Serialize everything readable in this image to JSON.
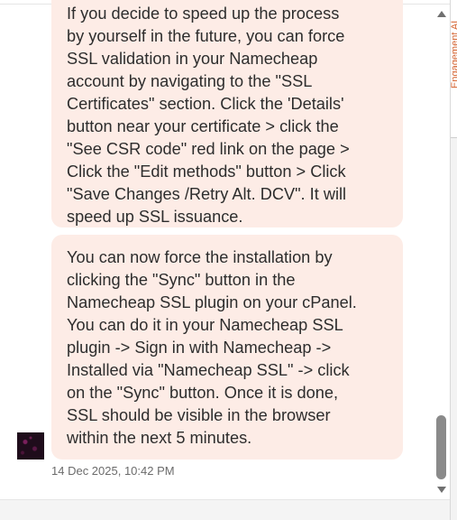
{
  "messages": [
    {
      "lines": [
        "If you decide to speed up the process",
        "by yourself in the future, you can force",
        "SSL validation in your Namecheap",
        "account by navigating to the \"SSL",
        "Certificates\" section. Click the 'Details'",
        "button near your certificate > click the",
        "\"See CSR code\" red link on the page >",
        "Click the \"Edit methods\" button > Click",
        "\"Save Changes /Retry Alt. DCV\". It will",
        "speed up SSL issuance."
      ]
    },
    {
      "lines": [
        "You can now force the installation by",
        "clicking the \"Sync\" button in the",
        "Namecheap SSL plugin on your cPanel.",
        "You can do it in your Namecheap SSL",
        "plugin -> Sign in with Namecheap ->",
        "Installed via \"Namecheap SSL\" -> click",
        "on the \"Sync\" button. Once it is done,",
        "SSL should be visible in the browser",
        "within the next 5 minutes."
      ]
    }
  ],
  "timestamp": "14 Dec 2025, 10:42 PM",
  "side_tab": {
    "label": "Engagement AI"
  },
  "colors": {
    "bubble_background": "#fdece6",
    "side_tab_text": "#d4622f",
    "scroll_thumb": "#8a8a8a"
  },
  "icons": {
    "scroll_up": "scroll-up-arrow-icon",
    "scroll_down": "scroll-down-arrow-icon"
  }
}
